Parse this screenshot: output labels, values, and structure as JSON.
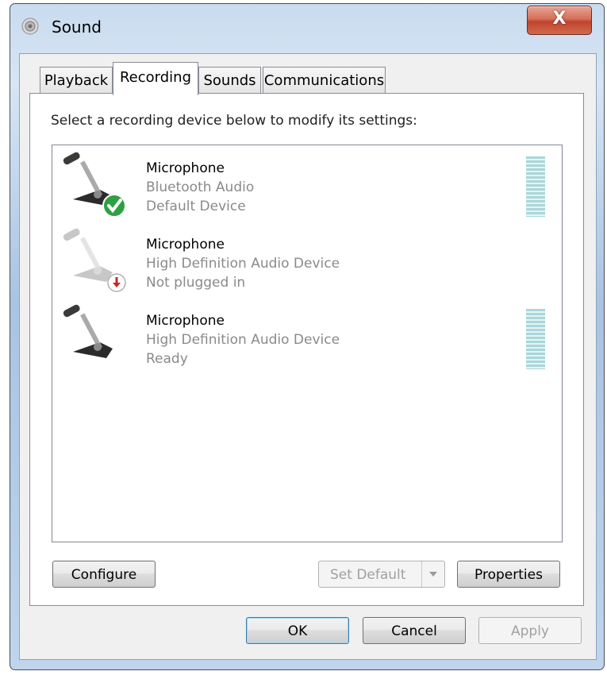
{
  "window": {
    "title": "Sound",
    "close_glyph": "X"
  },
  "tabs": [
    {
      "label": "Playback",
      "active": false
    },
    {
      "label": "Recording",
      "active": true
    },
    {
      "label": "Sounds",
      "active": false
    },
    {
      "label": "Communications",
      "active": false
    }
  ],
  "panel": {
    "instruction": "Select a recording device below to modify its settings:"
  },
  "devices": [
    {
      "name": "Microphone",
      "line1": "Bluetooth Audio",
      "line2": "Default Device",
      "status_icon": "green-check-icon",
      "has_meter": true
    },
    {
      "name": "Microphone",
      "line1": "High Definition Audio Device",
      "line2": "Not plugged in",
      "status_icon": "red-down-arrow-icon",
      "has_meter": false
    },
    {
      "name": "Microphone",
      "line1": "High Definition Audio Device",
      "line2": "Ready",
      "status_icon": "none",
      "has_meter": true
    }
  ],
  "buttons": {
    "configure": "Configure",
    "set_default": "Set Default",
    "properties": "Properties",
    "ok": "OK",
    "cancel": "Cancel",
    "apply": "Apply"
  },
  "colors": {
    "accent_check": "#2ea043",
    "accent_unplugged": "#c62828",
    "meter": "#a8d7da",
    "close_button": "#c9503a"
  }
}
